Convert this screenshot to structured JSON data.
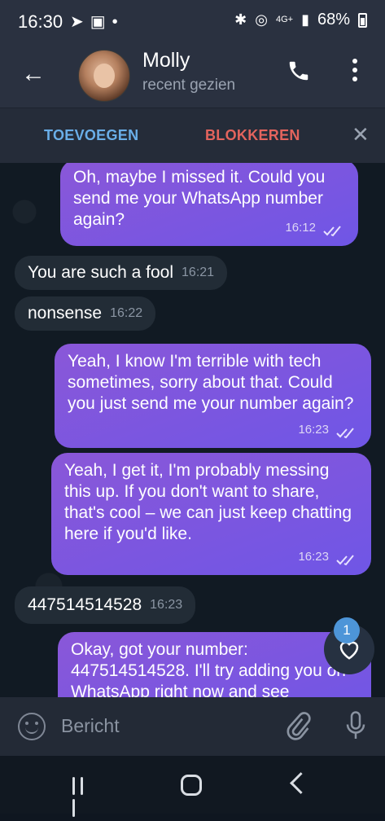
{
  "status_bar": {
    "time": "16:30",
    "network": "4G+",
    "battery": "68%",
    "left_icons": [
      "telegram-icon",
      "gallery-icon",
      "dot-icon"
    ],
    "right_icons": [
      "bluetooth-icon",
      "hotspot-icon",
      "signal-icon"
    ]
  },
  "header": {
    "name": "Molly",
    "status": "recent gezien"
  },
  "action_bar": {
    "add_label": "TOEVOEGEN",
    "block_label": "BLOKKEREN",
    "close_glyph": "✕"
  },
  "messages": [
    {
      "dir": "out",
      "text": "Oh, maybe I missed it. Could you send me your WhatsApp number again?",
      "time": "16:12"
    },
    {
      "dir": "in",
      "text": "You are such a fool",
      "time": "16:21"
    },
    {
      "dir": "in",
      "text": "nonsense",
      "time": "16:22"
    },
    {
      "dir": "out",
      "text": "Yeah, I know I'm terrible with tech sometimes, sorry about that. Could you just send me your number again?",
      "time": "16:23"
    },
    {
      "dir": "out",
      "text": "Yeah, I get it, I'm probably messing this up. If you don't want to share, that's cool – we can just keep chatting here if you'd like.",
      "time": "16:23"
    },
    {
      "dir": "in",
      "text": "447514514528",
      "time": "16:23"
    },
    {
      "dir": "out",
      "text": "Okay, got your number: 447514514528. I'll try adding you on WhatsApp right now and see",
      "time": ""
    }
  ],
  "reaction_badge": "1",
  "input": {
    "placeholder": "Bericht"
  },
  "colors": {
    "accent_blue": "#6aaee8",
    "danger_red": "#e4645d",
    "outgoing_bubble": "#7b57df",
    "incoming_bubble": "#222c36"
  }
}
